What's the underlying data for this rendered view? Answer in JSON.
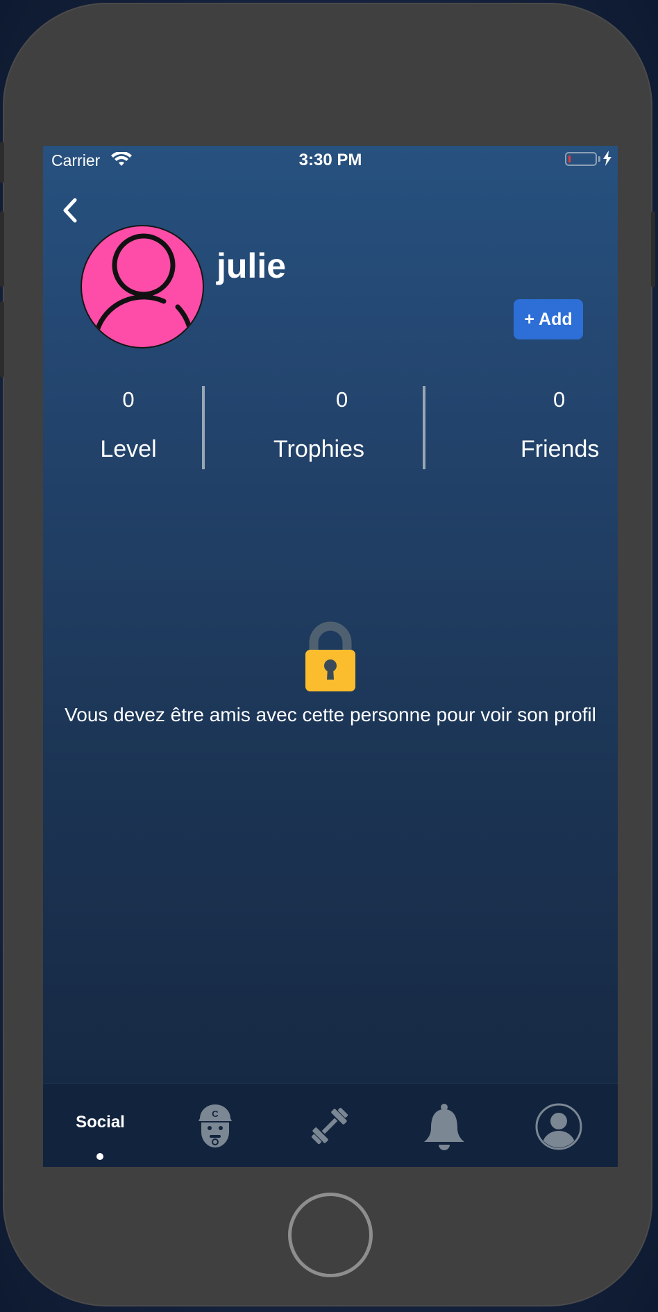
{
  "status_bar": {
    "carrier": "Carrier",
    "time": "3:30 PM"
  },
  "profile": {
    "username": "julie",
    "add_label": "+ Add",
    "avatar_color": "#fd4da8"
  },
  "stats": [
    {
      "value": "0",
      "label": "Level"
    },
    {
      "value": "0",
      "label": "Trophies"
    },
    {
      "value": "0",
      "label": "Friends"
    }
  ],
  "locked": {
    "message": "Vous devez être amis avec cette personne pour voir son profil",
    "icon": "lock-icon"
  },
  "tabbar": {
    "active": "Social",
    "items": [
      {
        "label": "Social",
        "icon": ""
      },
      {
        "label": "",
        "icon": "coach-icon"
      },
      {
        "label": "",
        "icon": "dumbbell-icon"
      },
      {
        "label": "",
        "icon": "bell-icon"
      },
      {
        "label": "",
        "icon": "profile-icon"
      }
    ]
  },
  "colors": {
    "accent": "#2d6fd6",
    "lock_body": "#fbbd2e",
    "lock_shackle": "#4f6170",
    "tab_icon": "#7c8794"
  }
}
